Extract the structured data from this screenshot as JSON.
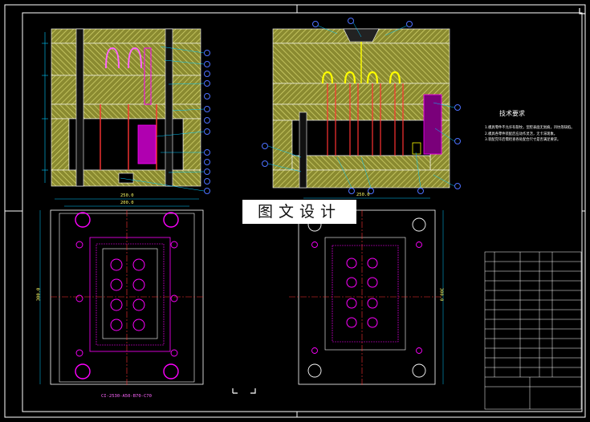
{
  "watermark": "图文设计",
  "notes": {
    "title": "技术要求",
    "lines": [
      "1.模具零件不允许有裂纹，型腔表面无划痕，凹坑等缺陷。",
      "2.模具各零件装配后应动作灵活，无卡滞现象。",
      "3.装配完毕后需检查各处配合尺寸是否满足要求。"
    ]
  },
  "dimensions": {
    "top_width": "250.0",
    "top_width_inner": "200.0",
    "right_top_width": "250.0",
    "left_height": "300.0",
    "right_height": "300.0",
    "part_code": "CI-2530-A50-B70-C70"
  },
  "colors": {
    "background": "#000000",
    "frame": "#ffffff",
    "hatch": "#bdbd5a",
    "part": "#ff00ff",
    "core": "#ffff00",
    "dim": "#00c8ff",
    "balloon": "#4d70ff"
  }
}
